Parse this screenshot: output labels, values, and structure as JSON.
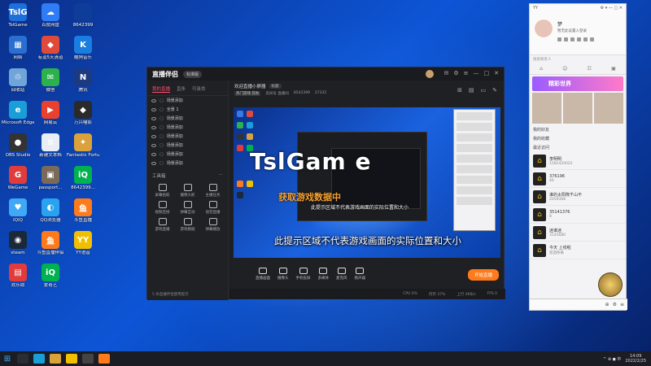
{
  "desktop_icons": [
    {
      "label": "TslGame",
      "name": "tslgame-logo",
      "color": "#1e6fd9",
      "glyph": "TslG"
    },
    {
      "label": "百度网盘",
      "name": "baidu-netdisk-icon",
      "color": "#2f7cf6",
      "glyph": "☁"
    },
    {
      "label": "8642399",
      "name": "id-label",
      "color": "#0d3d99",
      "glyph": ""
    },
    {
      "label": "网络",
      "name": "network-icon",
      "color": "#2a6fd0",
      "glyph": "▦"
    },
    {
      "label": "有道5天清道",
      "name": "youdao-icon",
      "color": "#e04a3a",
      "glyph": "◆"
    },
    {
      "label": "酷狗音乐",
      "name": "kugou-icon",
      "color": "#1a7de0",
      "glyph": "K"
    },
    {
      "label": "回收站",
      "name": "recycle-bin-icon",
      "color": "#6fa5d8",
      "glyph": "♲"
    },
    {
      "label": "微信",
      "name": "wechat-icon",
      "color": "#2bb24c",
      "glyph": "✉"
    },
    {
      "label": "腾讯",
      "name": "tencent-icon",
      "color": "#1c3a80",
      "glyph": "N"
    },
    {
      "label": "Microsoft Edge",
      "name": "edge-icon",
      "color": "#1a9ed8",
      "glyph": "e"
    },
    {
      "label": "网易云",
      "name": "netease-icon",
      "color": "#e8412f",
      "glyph": "▶"
    },
    {
      "label": "万兴喵影",
      "name": "filmora-icon",
      "color": "#2a2a2a",
      "glyph": "◆"
    },
    {
      "label": "OBS Studio",
      "name": "obs-icon",
      "color": "#333333",
      "glyph": "●"
    },
    {
      "label": "新建文本档",
      "name": "text-doc-icon",
      "color": "#e9eef5",
      "glyph": "≡"
    },
    {
      "label": "Fantastic Fortune...",
      "name": "game-icon",
      "color": "#d9a23a",
      "glyph": "✦"
    },
    {
      "label": "WeGame",
      "name": "wegame-icon",
      "color": "#e03c3c",
      "glyph": "G"
    },
    {
      "label": "passport...",
      "name": "passport-icon",
      "color": "#7a6a5a",
      "glyph": "▣"
    },
    {
      "label": "8642399...",
      "name": "iqiyi-icon",
      "color": "#00b14f",
      "glyph": "iQ"
    },
    {
      "label": "IQIQ",
      "name": "iqiq-icon",
      "color": "#3fa9f5",
      "glyph": "♥"
    },
    {
      "label": "QQ浏览器",
      "name": "qq-browser-icon",
      "color": "#2aa3ef",
      "glyph": "◐"
    },
    {
      "label": "斗鱼直播",
      "name": "douyu-icon",
      "color": "#ff7a1a",
      "glyph": "鱼"
    },
    {
      "label": "steam",
      "name": "steam-icon",
      "color": "#1b2838",
      "glyph": "◉"
    },
    {
      "label": "斗鱼直播伴侣",
      "name": "douyu-companion-icon",
      "color": "#ff7a1a",
      "glyph": "鱼"
    },
    {
      "label": "YY语音",
      "name": "yy-icon",
      "color": "#f0c000",
      "glyph": "YY"
    },
    {
      "label": "欢乐颂",
      "name": "huanle-icon",
      "color": "#e23b3b",
      "glyph": "▤"
    },
    {
      "label": "爱奇艺",
      "name": "iqiyi2-icon",
      "color": "#00b14f",
      "glyph": "iQ"
    }
  ],
  "app": {
    "logo": "直播伴侣",
    "edition": "标准版",
    "tabs": [
      "我的直播",
      "直条",
      "可录类"
    ],
    "scenes": [
      "场景添加",
      "全景 1",
      "场景添加",
      "场景添加",
      "场景添加",
      "场景添加",
      "场景添加",
      "场景添加"
    ],
    "tools_title": "工具箱",
    "tools": [
      "屏幕拾取",
      "摄像头抓",
      "主播任务",
      "视频连接",
      "弹幕互动",
      "语音直播",
      "游戏直播",
      "游戏数据",
      "弹幕播放"
    ],
    "footer_text": "5 条直播伴侣使用提示",
    "stream_title": "欢迎直播小屏器",
    "stream_badge": "标题",
    "stream_category": "热门游戏·其他",
    "stream_meta": [
      "房间号 直播间",
      "8542399",
      "27335"
    ],
    "overlay_logo": "TslGam e",
    "overlay_get": "获取游戏数据中",
    "overlay_hint_small": "此提示区域不代表游戏画面的实际位置和大小",
    "overlay_hint": "此提示区域不代表游戏画面的实际位置和大小",
    "bottom_buttons": [
      "直播画面",
      "摄像头",
      "手机投屏",
      "多媒体",
      "麦克风",
      "扬声器"
    ],
    "go_live": "开始直播",
    "status": [
      "CPU 0%",
      "内存 37%",
      "上行 0KB/s",
      "FPS 0"
    ]
  },
  "chat": {
    "header": "YY",
    "name": "梦",
    "signature": "暂无此设置入登录",
    "search_placeholder": "搜索联系人",
    "banner": "精彩世界",
    "sections": [
      "我的好友",
      "我的收藏",
      "最近访问"
    ],
    "contacts": [
      {
        "name": "李明明",
        "id": "1582420022"
      },
      {
        "name": "376196",
        "id": "46"
      },
      {
        "name": "谁的太阳熊千山不",
        "id": "2059368"
      },
      {
        "name": "35141376",
        "id": "8"
      },
      {
        "name": "迷谁迷",
        "id": "3145680"
      },
      {
        "name": "今天 上线啦",
        "id": "欢迎你来"
      }
    ]
  },
  "taskbar": {
    "time": "14:09",
    "date": "2022/2/25",
    "tray_text": "^ ⊕ ◼ 中"
  }
}
